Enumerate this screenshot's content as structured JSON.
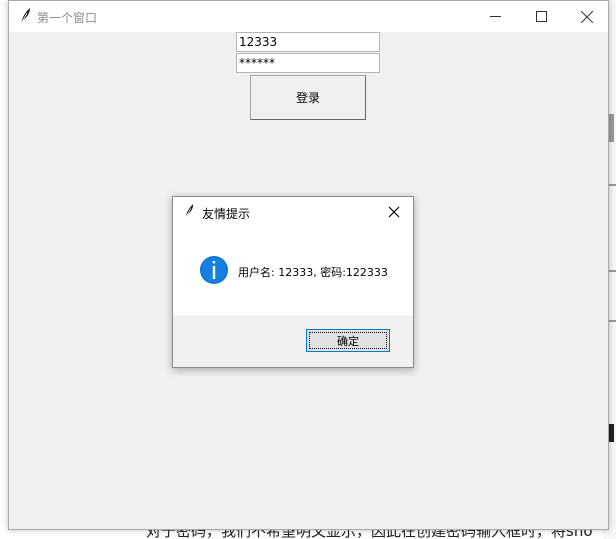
{
  "window": {
    "title": "第一个窗口",
    "icon": "feather-icon"
  },
  "form": {
    "username_value": "12333",
    "password_value": "******",
    "login_label": "登录"
  },
  "dialog": {
    "title": "友情提示",
    "icon": "info-icon",
    "message": "用户名: 12333, 密码:122333",
    "ok_label": "确定"
  },
  "background": {
    "partial_text": "对于密码，我们不希望明文显示，因此在创建密码输入框时，将sho"
  },
  "colors": {
    "info_blue": "#0078d7",
    "window_bg": "#f0f0f0"
  }
}
